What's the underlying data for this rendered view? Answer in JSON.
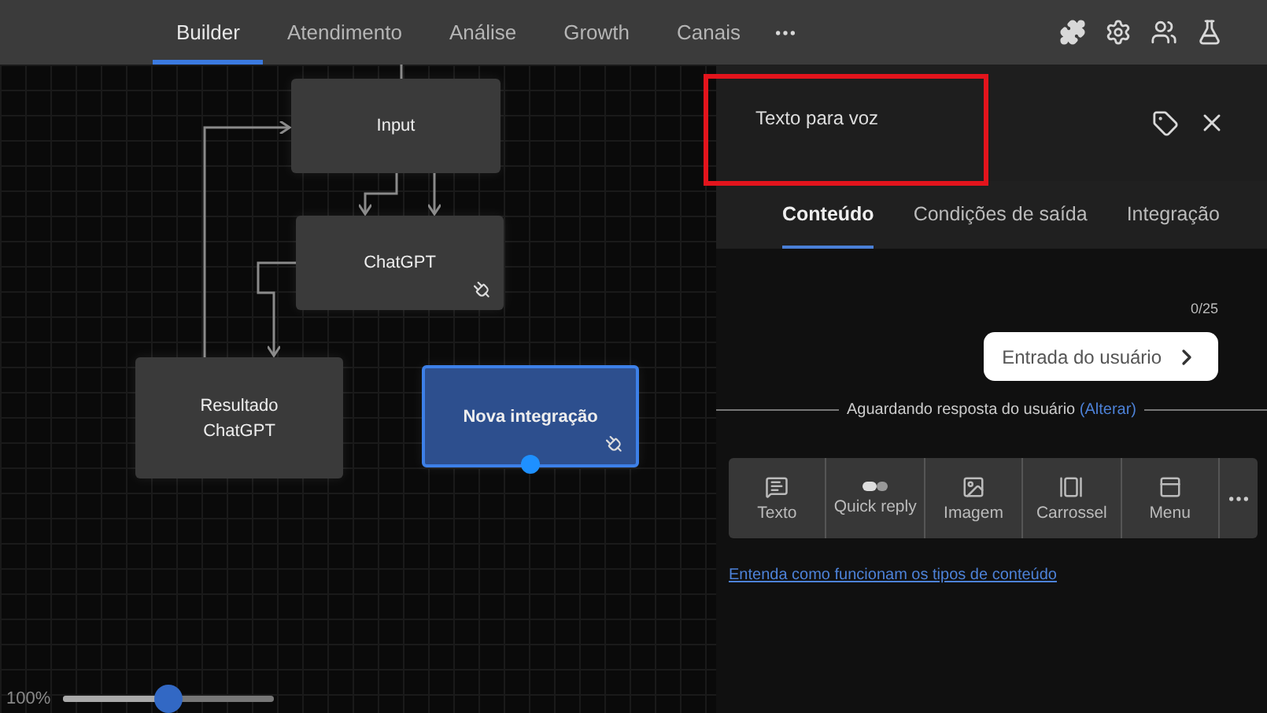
{
  "top_nav": {
    "tabs": [
      {
        "label": "Builder",
        "selected": true
      },
      {
        "label": "Atendimento",
        "selected": false
      },
      {
        "label": "Análise",
        "selected": false
      },
      {
        "label": "Growth",
        "selected": false
      },
      {
        "label": "Canais",
        "selected": false
      }
    ]
  },
  "canvas": {
    "nodes": [
      {
        "label": "Input",
        "kind": "content",
        "selected": false
      },
      {
        "label": "ChatGPT",
        "kind": "integration",
        "selected": false
      },
      {
        "label": "Resultado ChatGPT",
        "kind": "content",
        "selected": false
      },
      {
        "label": "Nova integração",
        "kind": "integration",
        "selected": true
      }
    ],
    "zoom": {
      "reading": "100%",
      "level": 0.5
    }
  },
  "panel": {
    "title": "Texto para voz",
    "highlighted": true,
    "tabs": [
      {
        "label": "Conteúdo",
        "selected": true
      },
      {
        "label": "Condições de saída",
        "selected": false
      },
      {
        "label": "Integração",
        "selected": false
      }
    ],
    "counter": "0/25",
    "input_button": "Entrada do usuário",
    "waiting_text": "Aguardando resposta do usuário",
    "waiting_link": "(Alterar)",
    "content_types": [
      {
        "label": "Texto",
        "kind": "text"
      },
      {
        "label": "Quick reply",
        "kind": "quick_reply"
      },
      {
        "label": "Imagem",
        "kind": "image"
      },
      {
        "label": "Carrossel",
        "kind": "carousel"
      },
      {
        "label": "Menu",
        "kind": "menu"
      }
    ],
    "help_link": "Entenda como funcionam os tipos de conteúdo"
  }
}
